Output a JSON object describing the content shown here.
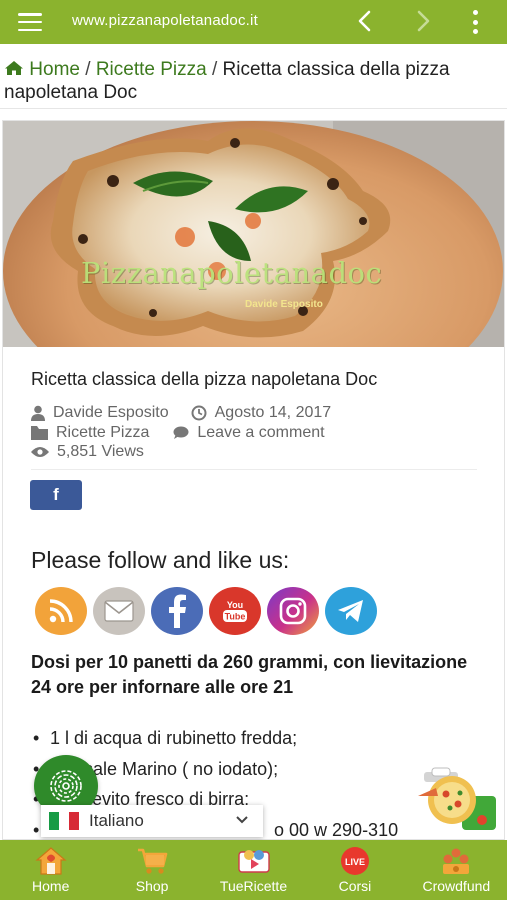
{
  "browser": {
    "url": "www.pizzanapoletanadoc.it"
  },
  "breadcrumb": {
    "home": "Home",
    "sep1": "/",
    "category": "Ricette Pizza",
    "sep2": "/",
    "current": "Ricetta classica della pizza napoletana Doc"
  },
  "hero": {
    "watermark": "Pizzanapoletanadoc",
    "author_caption": "Davide Esposito"
  },
  "post": {
    "title": "Ricetta classica della pizza napoletana Doc",
    "author": "Davide Esposito",
    "date": "Agosto 14, 2017",
    "category": "Ricette Pizza",
    "comment_link": "Leave a comment",
    "views": "5,851 Views"
  },
  "share": {
    "facebook_label": "f"
  },
  "follow": {
    "title": "Please follow and like us:",
    "networks": [
      "rss",
      "email",
      "facebook",
      "youtube",
      "instagram",
      "telegram"
    ],
    "youtube_text": "You Tube"
  },
  "recipe": {
    "dosi": "Dosi per 10 panetti da 260 grammi, con lievitazione 24 ore per infornare alle ore 21",
    "ingredients": [
      "1 l di acqua di rubinetto fredda;",
      "g di sale Marino ( no iodato);",
      "q di lievito fresco di birra;",
      "o 00 w 290-310"
    ]
  },
  "language": {
    "selected": "Italiano"
  },
  "bottom_nav": [
    {
      "label": "Home",
      "icon": "home-icon"
    },
    {
      "label": "Shop",
      "icon": "cart-icon"
    },
    {
      "label": "TueRicette",
      "icon": "video-icon"
    },
    {
      "label": "Corsi",
      "icon": "live-icon",
      "badge": "LIVE"
    },
    {
      "label": "Crowdfund",
      "icon": "crowdfund-icon"
    }
  ],
  "colors": {
    "brand_green": "#8bb32e",
    "link_green": "#3d7a1e",
    "facebook_blue": "#3b5998"
  }
}
